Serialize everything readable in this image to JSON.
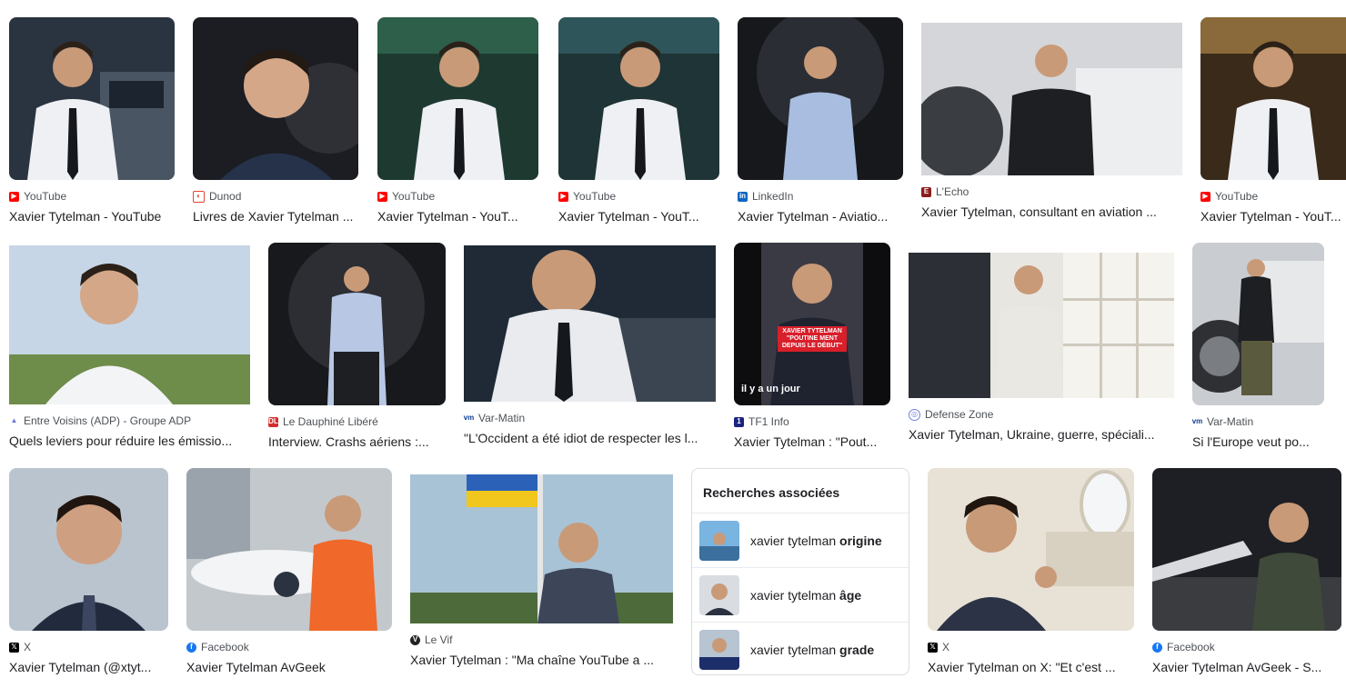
{
  "colors": {
    "youtube": "#ff0000",
    "linkedin": "#0a66c2",
    "facebook": "#1877f2",
    "x": "#000000",
    "lecho": "#8b1c1c",
    "dauphine": "#d32f2f",
    "tf1": "#1a237e",
    "varmatin": "#0b3d91",
    "levif": "#222222",
    "adp": "#6b7bd6",
    "dunod": "#e8442c",
    "defense": "#6f7fd8"
  },
  "results": [
    {
      "source": "YouTube",
      "title": "Xavier Tytelman - YouTube",
      "icon": "youtube-icon"
    },
    {
      "source": "Dunod",
      "title": "Livres de Xavier Tytelman ...",
      "icon": "dunod-icon"
    },
    {
      "source": "YouTube",
      "title": "Xavier Tytelman - YouT...",
      "icon": "youtube-icon"
    },
    {
      "source": "YouTube",
      "title": "Xavier Tytelman - YouT...",
      "icon": "youtube-icon"
    },
    {
      "source": "LinkedIn",
      "title": "Xavier Tytelman - Aviatio...",
      "icon": "linkedin-icon"
    },
    {
      "source": "L'Echo",
      "title": "Xavier Tytelman, consultant en aviation ...",
      "icon": "lecho-icon"
    },
    {
      "source": "YouTube",
      "title": "Xavier Tytelman - YouT...",
      "icon": "youtube-icon"
    },
    {
      "source": "Entre Voisins (ADP) - Groupe ADP",
      "title": "Quels leviers pour réduire les émissio...",
      "icon": "adp-icon"
    },
    {
      "source": "Le Dauphiné Libéré",
      "title": "Interview. Crashs aériens :...",
      "icon": "dauphine-icon"
    },
    {
      "source": "Var-Matin",
      "title": "\"L'Occident a été idiot de respecter les l...",
      "icon": "varmatin-icon"
    },
    {
      "source": "TF1 Info",
      "title": "Xavier Tytelman : \"Pout...",
      "icon": "tf1-icon",
      "overlay": "il y a un jour",
      "caption": [
        "XAVIER TYTELMAN",
        "\"POUTINE MENT",
        "DEPUIS LE DÉBUT\""
      ]
    },
    {
      "source": "Defense Zone",
      "title": "Xavier Tytelman, Ukraine, guerre, spéciali...",
      "icon": "defense-zone-icon"
    },
    {
      "source": "Var-Matin",
      "title": "Si l'Europe veut po...",
      "icon": "varmatin-icon"
    },
    {
      "source": "X",
      "title": "Xavier Tytelman (@xtyt...",
      "icon": "x-icon"
    },
    {
      "source": "Facebook",
      "title": "Xavier Tytelman AvGeek",
      "icon": "facebook-icon"
    },
    {
      "source": "Le Vif",
      "title": "Xavier Tytelman : \"Ma chaîne YouTube a ...",
      "icon": "levif-icon"
    },
    {
      "source": "X",
      "title": "Xavier Tytelman on X: \"Et c'est ...",
      "icon": "x-icon"
    },
    {
      "source": "Facebook",
      "title": "Xavier Tytelman AvGeek - S...",
      "icon": "facebook-icon"
    }
  ],
  "related": {
    "title": "Recherches associées",
    "items": [
      {
        "prefix": "xavier tytelman ",
        "bold": "origine"
      },
      {
        "prefix": "xavier tytelman ",
        "bold": "âge"
      },
      {
        "prefix": "xavier tytelman ",
        "bold": "grade"
      }
    ]
  }
}
